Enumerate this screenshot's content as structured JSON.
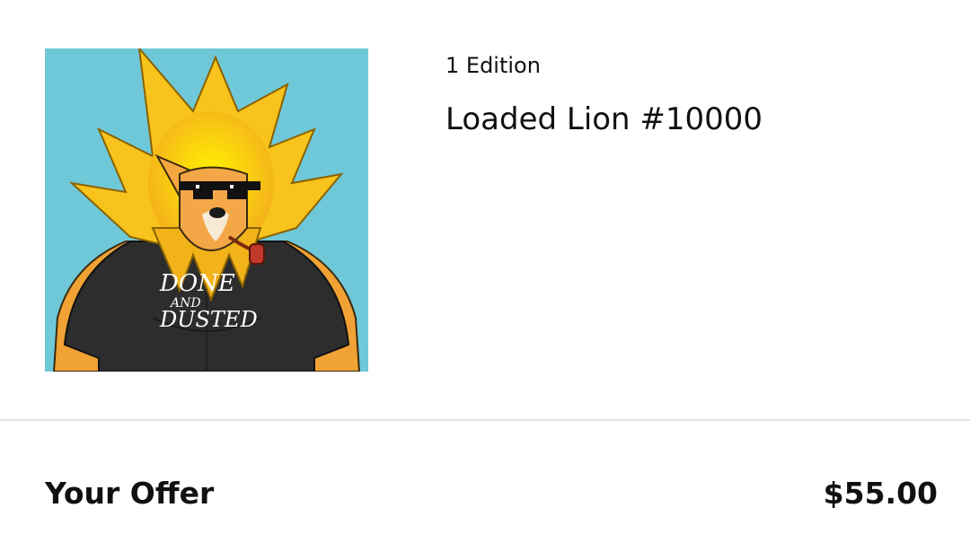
{
  "item": {
    "edition_label": "1 Edition",
    "title": "Loaded Lion #10000",
    "artwork": {
      "icon": "lion-nft-artwork",
      "shirt_text_line1": "DONE",
      "shirt_text_line2": "AND",
      "shirt_text_line3": "DUSTED",
      "background_color": "#6fc8d8"
    }
  },
  "offer": {
    "label": "Your Offer",
    "amount": "$55.00"
  }
}
